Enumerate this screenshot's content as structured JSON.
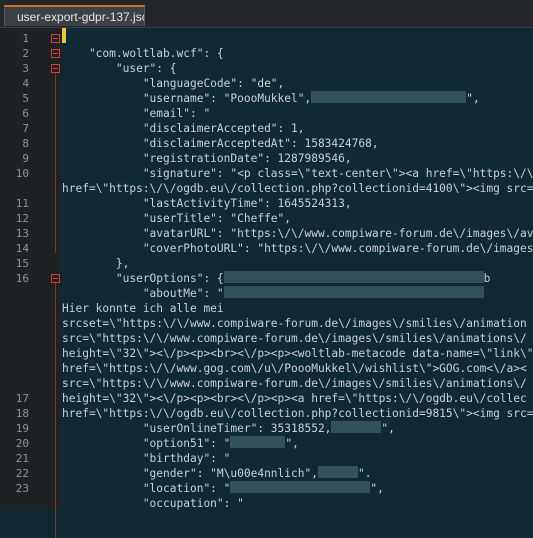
{
  "tab": {
    "title": "user-export-gdpr-137.json"
  },
  "line_numbers": [
    "1",
    "2",
    "3",
    "4",
    "5",
    "6",
    "7",
    "8",
    "9",
    "10",
    "11",
    "12",
    "13",
    "14",
    "15",
    "16",
    "17",
    "18",
    "19",
    "20",
    "21",
    "22",
    "23"
  ],
  "lines": [
    "",
    "    \"com.woltlab.wcf\": {",
    "        \"user\": {",
    "            \"languageCode\": \"de\",",
    "            \"username\": \"PoooMukkel\",",
    "            \"email\": \"",
    "            \"disclaimerAccepted\": 1,",
    "            \"disclaimerAcceptedAt\": 1583424768,",
    "            \"registrationDate\": 1287989546,",
    "            \"signature\": \"<p class=\\\"text-center\\\"><a href=\\\"https:\\/\\/www.",
    "href=\\\"https:\\/\\/ogdb.eu\\/collection.php?collectionid=4100\\\"><img src=",
    "            \"lastActivityTime\": 1645524313,",
    "            \"userTitle\": \"Cheffe\",",
    "            \"avatarURL\": \"https:\\/\\/www.compiware-forum.de\\/images\\/avatars",
    "            \"coverPhotoURL\": \"https:\\/\\/www.compiware-forum.de\\/images\\/cove",
    "        },",
    "        \"userOptions\": {",
    "            \"aboutMe\": \"",
    "Hier konnte ich alle mei",
    "srcset=\\\"https:\\/\\/www.compiware-forum.de\\/images\\/smilies\\/animation",
    "src=\\\"https:\\/\\/www.compiware-forum.de\\/images\\/smilies\\/animations\\/",
    "height=\\\"32\\\"><\\/p><p><br><\\/p><p><woltlab-metacode data-name=\\\"link\\\"",
    "href=\\\"https:\\/\\/www.gog.com\\/u\\/PoooMukkel\\/wishlist\\\">GOG.com<\\/a><",
    "src=\\\"https:\\/\\/www.compiware-forum.de\\/images\\/smilies\\/animations\\/",
    "height=\\\"32\\\"><\\/p><p><br><\\/p><p><a href=\\\"https:\\/\\/ogdb.eu\\/collec",
    "href=\\\"https:\\/\\/ogdb.eu\\/collection.php?collectionid=9815\\\"><img src=",
    "            \"userOnlineTimer\": 35318552,",
    "            \"option51\": \"",
    "            \"birthday\": \"",
    "            \"gender\": \"M\\u00e4nnlich\",",
    "            \"location\": \"",
    "            \"occupation\": \""
  ],
  "line_suffixes": {
    "5": "\",",
    "17": "b",
    "27": "\",",
    "28": "\",",
    "30": "\".",
    "31": "\","
  },
  "fold_line_numbers": [
    "1",
    "2",
    "3",
    "16"
  ],
  "colors": {
    "background": "#0f2a33",
    "gutter": "#1f2225",
    "text": "#c7d1d6",
    "line_number": "#8a9197",
    "fold_marker": "#d63b3b",
    "tab_accent": "#d96f23",
    "caret": "#e8c73a",
    "redaction": "#31525b"
  },
  "icons": [
    "fold-collapse-icon"
  ]
}
